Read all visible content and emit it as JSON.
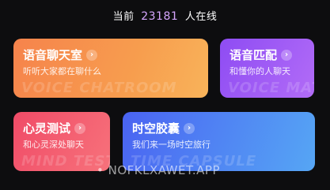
{
  "header": {
    "prefix": "当前",
    "online_count": "23181",
    "suffix": "人在线"
  },
  "cards": {
    "voice": {
      "title": "语音聊天室",
      "subtitle": "听听大家都在聊什么",
      "watermark": "VOICE CHATROOM"
    },
    "match": {
      "title": "语音匹配",
      "subtitle": "和懂你的人聊天",
      "watermark": "VOICE MATCH"
    },
    "mind": {
      "title": "心灵测试",
      "subtitle": "和心灵深处聊天",
      "watermark": "MIND TEST"
    },
    "time": {
      "title": "时空胶囊",
      "subtitle": "我们来一场时空旅行",
      "watermark": "TIME CAPSULE"
    }
  },
  "site_mark": "• NOFKLXAWET.APP",
  "colors": {
    "background": "#0d0d0f",
    "count_accent": "#d6a6ff"
  },
  "icons": {
    "card_arrow": "chevron-right-icon"
  }
}
